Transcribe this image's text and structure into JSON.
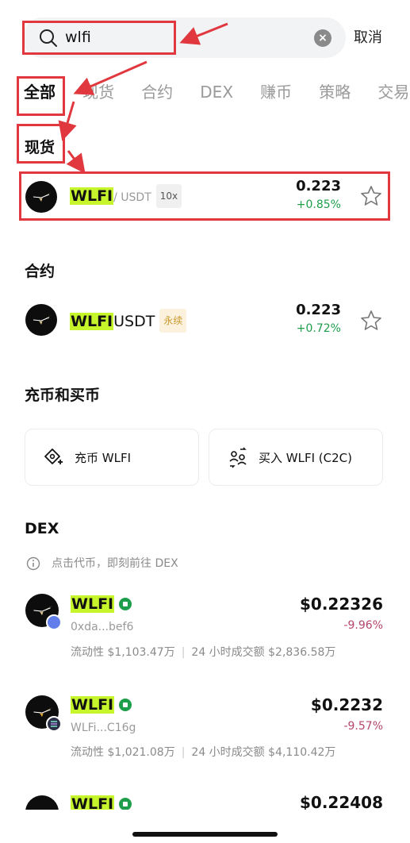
{
  "search": {
    "query": "wlfi",
    "cancel_label": "取消"
  },
  "tabs": [
    "全部",
    "现货",
    "合约",
    "DEX",
    "赚币",
    "策略",
    "交易"
  ],
  "spot": {
    "title": "现货",
    "item": {
      "base": "WLFI",
      "quote": "/ USDT",
      "leverage": "10x",
      "price": "0.223",
      "change": "+0.85%"
    }
  },
  "futures": {
    "title": "合约",
    "item": {
      "base": "WLFI",
      "rest": "USDT",
      "badge": "永续",
      "price": "0.223",
      "change": "+0.72%"
    }
  },
  "deposit": {
    "title": "充币和买币",
    "deposit_label": "充币 WLFI",
    "buy_label": "买入 WLFI (C2C)"
  },
  "dex": {
    "title": "DEX",
    "hint": "点击代币，即刻前往 DEX",
    "items": [
      {
        "name": "WLFI",
        "addr": "0xda...bef6",
        "price": "$0.22326",
        "change": "-9.96%",
        "liquidity": "流动性 $1,103.47万",
        "volume": "24 小时成交额 $2,836.58万",
        "chain_color": "#627eea"
      },
      {
        "name": "WLFI",
        "addr": "WLFi...C16g",
        "price": "$0.2232",
        "change": "-9.57%",
        "liquidity": "流动性 $1,021.08万",
        "volume": "24 小时成交额 $4,110.42万",
        "chain_color": "#2a2f45"
      },
      {
        "name": "WLFI",
        "price": "$0.22408"
      }
    ]
  },
  "colors": {
    "highlight": "#c6f52c",
    "up": "#1e9e4a",
    "down": "#b4456d",
    "annotation": "#e0383e"
  }
}
